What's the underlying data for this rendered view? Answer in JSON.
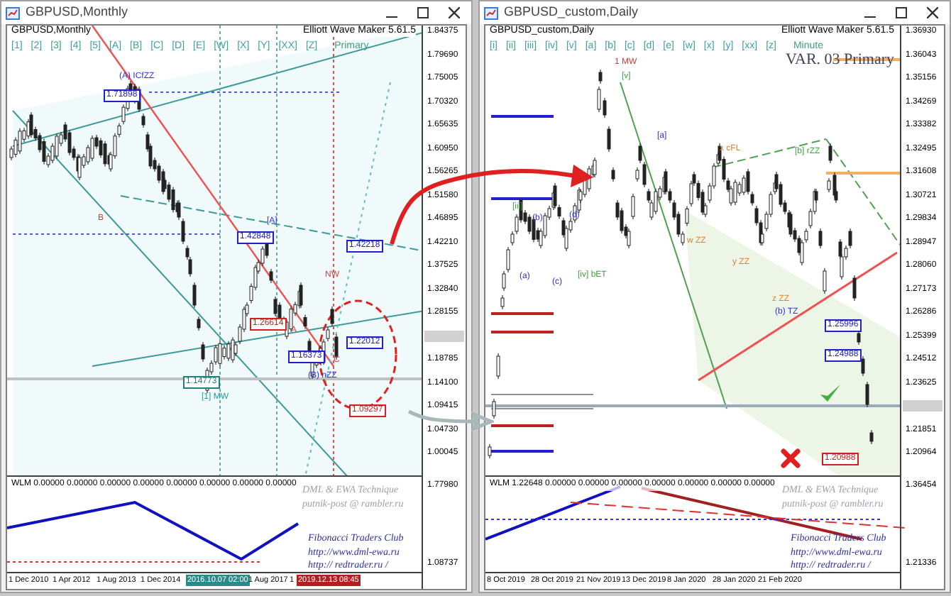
{
  "windows": [
    {
      "title": "GBPUSD,Monthly",
      "chart_header": "GBPUSD,Monthly",
      "expert_name": "Elliott Wave Maker 5.61.5",
      "wave_labels": [
        "[1]",
        "[2]",
        "[3]",
        "[4]",
        "[5]",
        "[A]",
        "[B]",
        "[C]",
        "[D]",
        "[E]",
        "[W]",
        "[X]",
        "[Y]",
        "[XX]",
        "[Z]",
        "Primary"
      ],
      "chart_labels": [
        {
          "text": "(A) ICfZZ",
          "kind": "text_blue"
        },
        {
          "text": "1.71898",
          "kind": "box_blue"
        },
        {
          "text": "B",
          "kind": "text_red"
        },
        {
          "text": "[A]",
          "kind": "text_blue"
        },
        {
          "text": "1.42848",
          "kind": "box_blue"
        },
        {
          "text": "1.42218",
          "kind": "box_blue"
        },
        {
          "text": "1.26614",
          "kind": "box_red"
        },
        {
          "text": "A",
          "kind": "text_red"
        },
        {
          "text": "C",
          "kind": "text_red"
        },
        {
          "text": "1.16373",
          "kind": "box_blue"
        },
        {
          "text": "(B) nZZ",
          "kind": "text_blue"
        },
        {
          "text": "1.22012",
          "kind": "box_blue"
        },
        {
          "text": "1.14773",
          "kind": "box_teal"
        },
        {
          "text": "[1] MW",
          "kind": "text_teal"
        },
        {
          "text": "NW",
          "kind": "text_red"
        },
        {
          "text": "1.09297",
          "kind": "box_red"
        }
      ],
      "price_ticks": [
        "1.84375",
        "1.79690",
        "1.75005",
        "1.70320",
        "1.65635",
        "1.60950",
        "1.56265",
        "1.51580",
        "1.46895",
        "1.42210",
        "1.37525",
        "1.32840",
        "1.28155",
        "1.18785",
        "1.14100",
        "1.09415",
        "1.04730",
        "1.00045"
      ],
      "indicator_header": "WLM 0.00000 0.00000 0.00000 0.00000 0.00000 0.00000 0.00000 0.00000",
      "indicator_ticks": [
        "1.77980",
        "1.08737"
      ],
      "pane_notes": [
        "DML & EWA Technique",
        "putnik-post @ rambler.ru",
        "Fibonacci Traders Club",
        "http://www.dml-ewa.ru",
        "http:// redtrader.ru /"
      ],
      "date_ticks": [
        {
          "text": "1 Dec 2010",
          "kind": "plain"
        },
        {
          "text": "1 Apr 2012",
          "kind": "plain"
        },
        {
          "text": "1 Aug 2013",
          "kind": "plain"
        },
        {
          "text": "1 Dec 2014",
          "kind": "plain"
        },
        {
          "text": "2016.10.07 02:00",
          "kind": "teal"
        },
        {
          "text": "1 Aug 2017",
          "kind": "plain"
        },
        {
          "text": "1",
          "kind": "plain"
        },
        {
          "text": "2019.12.13 08:45",
          "kind": "red"
        }
      ]
    },
    {
      "title": "GBPUSD_custom,Daily",
      "chart_header": "GBPUSD_custom,Daily",
      "expert_name": "Elliott Wave Maker 5.61.5",
      "variant": "VAR. 03 Primary",
      "wave_labels": [
        "[i]",
        "[ii]",
        "[iii]",
        "[iv]",
        "[v]",
        "[a]",
        "[b]",
        "[c]",
        "[d]",
        "[e]",
        "[w]",
        "[x]",
        "[y]",
        "[xx]",
        "[z]",
        "Minute"
      ],
      "chart_labels": [
        {
          "text": "1 MW",
          "kind": "text_red"
        },
        {
          "text": "[v]",
          "kind": "text_green"
        },
        {
          "text": "[a]",
          "kind": "text_blue"
        },
        {
          "text": "x cFL",
          "kind": "text_orange"
        },
        {
          "text": "[b] rZZ",
          "kind": "text_green"
        },
        {
          "text": "[iii]",
          "kind": "text_green"
        },
        {
          "text": "(b)",
          "kind": "text_blue"
        },
        {
          "text": "(d)",
          "kind": "text_blue"
        },
        {
          "text": "(a)",
          "kind": "text_blue"
        },
        {
          "text": "(c)",
          "kind": "text_blue"
        },
        {
          "text": "[iv] bET",
          "kind": "text_green"
        },
        {
          "text": "w ZZ",
          "kind": "text_orange"
        },
        {
          "text": "y ZZ",
          "kind": "text_orange"
        },
        {
          "text": "z ZZ",
          "kind": "text_orange"
        },
        {
          "text": "(b) TZ",
          "kind": "text_blue"
        },
        {
          "text": "1.25996",
          "kind": "box_blue"
        },
        {
          "text": "1.24988",
          "kind": "box_blue"
        },
        {
          "text": "1.20988",
          "kind": "box_red"
        }
      ],
      "price_ticks": [
        "1.36930",
        "1.36043",
        "1.35156",
        "1.34269",
        "1.33382",
        "1.32495",
        "1.31608",
        "1.30721",
        "1.29834",
        "1.28947",
        "1.28060",
        "1.27173",
        "1.26286",
        "1.25399",
        "1.24512",
        "1.23625",
        "1.21851",
        "1.20964"
      ],
      "indicator_header": "WLM 1.22648 0.00000 0.00000 0.00000 0.00000 0.00000 0.00000 0.00000",
      "indicator_ticks": [
        "1.36454",
        "1.21336"
      ],
      "pane_notes": [
        "DML & EWA Technique",
        "putnik-post @ rambler.ru",
        "Fibonacci Traders Club",
        "http://www.dml-ewa.ru",
        "http:// redtrader.ru /"
      ],
      "date_ticks": [
        {
          "text": "8 Oct 2019",
          "kind": "plain"
        },
        {
          "text": "28 Oct 2019",
          "kind": "plain"
        },
        {
          "text": "21 Nov 2019",
          "kind": "plain"
        },
        {
          "text": "13 Dec 2019",
          "kind": "plain"
        },
        {
          "text": "8 Jan 2020",
          "kind": "plain"
        },
        {
          "text": "28 Jan 2020",
          "kind": "plain"
        },
        {
          "text": "21 Feb 2020",
          "kind": "plain"
        }
      ]
    }
  ]
}
